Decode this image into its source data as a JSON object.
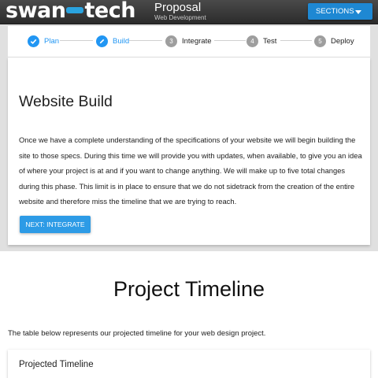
{
  "header": {
    "logo_left": "swan",
    "logo_right": "tech",
    "title": "Proposal",
    "subtitle": "Web Development",
    "sections_label": "SECTIONS"
  },
  "stepper": {
    "steps": [
      {
        "label": "Plan",
        "number": "",
        "icon": "check-icon",
        "state": "complete"
      },
      {
        "label": "Build",
        "number": "",
        "icon": "pencil-icon",
        "state": "active"
      },
      {
        "label": "Integrate",
        "number": "3",
        "state": "pending"
      },
      {
        "label": "Test",
        "number": "4",
        "state": "pending"
      },
      {
        "label": "Deploy",
        "number": "5",
        "state": "pending"
      }
    ]
  },
  "card": {
    "title": "Website Build",
    "body": "Once we have a complete understanding of the specifications of your website we will begin building the site to those specs. During this time we will provide you with updates, when available, to give you an idea of where your project is at and if you want to change anything. We will make up to five total changes during this phase. This limit is in place to ensure that we do not sidetrack from the creation of the entire website and therefore miss the timeline that we are trying to reach.",
    "next_label": "NEXT: INTEGRATE"
  },
  "timeline": {
    "heading": "Project Timeline",
    "intro": "The table below represents our projected timeline for your web design project.",
    "card_title": "Projected Timeline"
  },
  "colors": {
    "accent": "#2196f3",
    "header_bg": "#3a3a3a",
    "band_bg": "#e0e0e0"
  }
}
